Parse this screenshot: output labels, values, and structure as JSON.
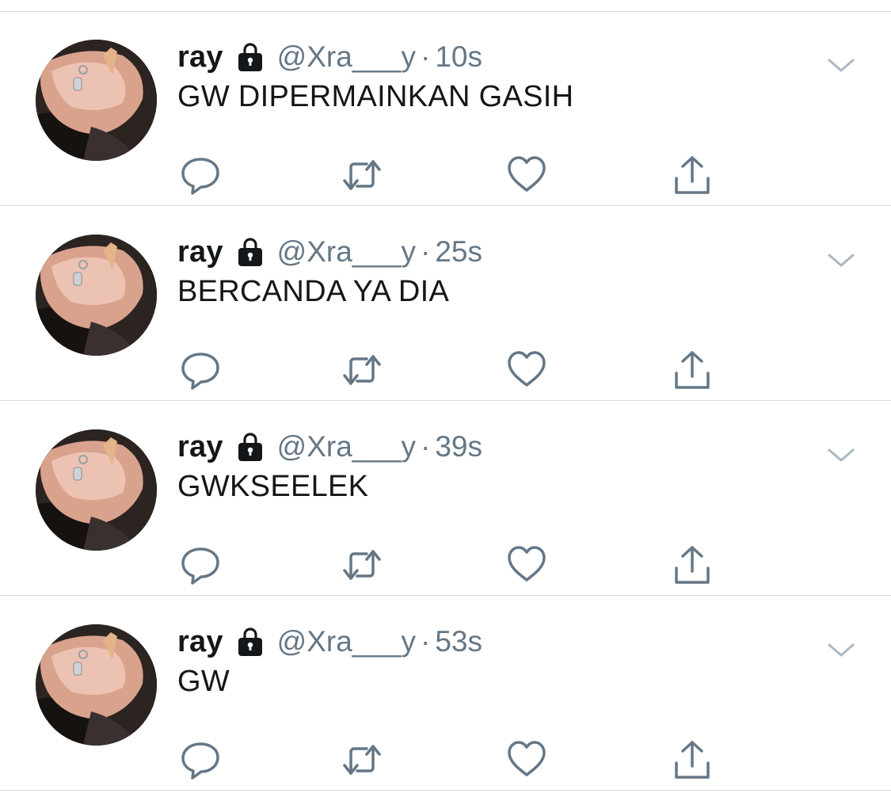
{
  "timeline": {
    "tweets": [
      {
        "name": "ray",
        "handle": "@Xra___y",
        "separator": "·",
        "time": "10s",
        "text": "GW DIPERMAINKAN GASIH"
      },
      {
        "name": "ray",
        "handle": "@Xra___y",
        "separator": "·",
        "time": "25s",
        "text": "BERCANDA YA DIA"
      },
      {
        "name": "ray",
        "handle": "@Xra___y",
        "separator": "·",
        "time": "39s",
        "text": "GWKSEELEK"
      },
      {
        "name": "ray",
        "handle": "@Xra___y",
        "separator": "·",
        "time": "53s",
        "text": "GW"
      }
    ]
  },
  "icons": {
    "protected": "lock-icon",
    "menu": "chevron-down-icon",
    "reply": "reply-icon",
    "retweet": "retweet-icon",
    "like": "heart-icon",
    "share": "share-icon"
  },
  "colors": {
    "name": "#14171a",
    "meta": "#657786",
    "icon": "#657786",
    "divider": "#d6d9dc",
    "background": "#ffffff"
  }
}
